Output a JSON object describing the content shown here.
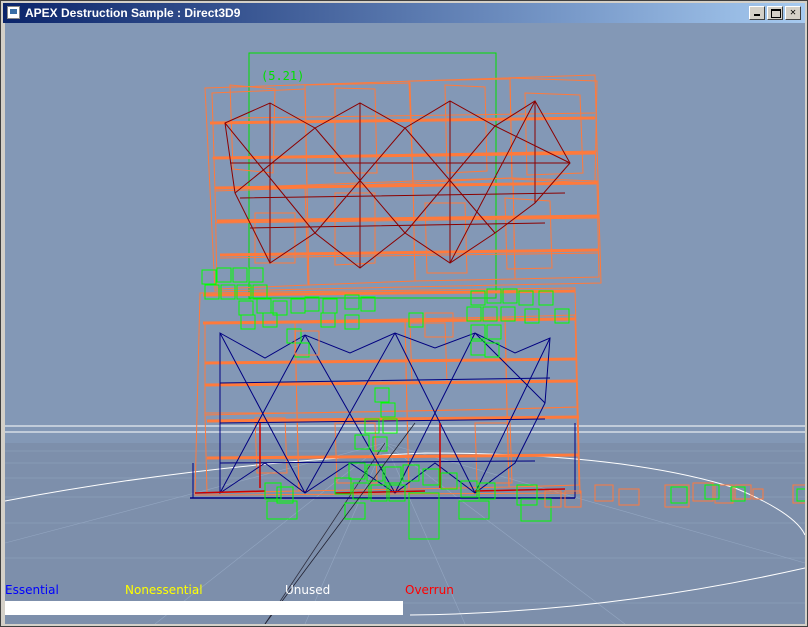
{
  "window": {
    "title": "APEX Destruction Sample : Direct3D9",
    "controls": {
      "minimize": "_",
      "maximize": "□",
      "close": "X"
    }
  },
  "viewport": {
    "background_color": "#8398b6",
    "floor_color": "#7d90ab",
    "wire_colors": {
      "orange": "#ff7a3c",
      "dark_red": "#8b0000",
      "blue": "#000080",
      "green": "#00ff00",
      "white": "#ffffff"
    }
  },
  "overlay_label": "(5.21)",
  "budget_legend": {
    "essential": {
      "label": "Essential",
      "color": "#0000ff"
    },
    "nonessential": {
      "label": "Nonessential",
      "color": "#ffff00"
    },
    "unused": {
      "label": "Unused",
      "color": "#ffffff"
    },
    "overrun": {
      "label": "Overrun",
      "color": "#ff0000"
    }
  },
  "budget_bar_color": "#ffffff"
}
